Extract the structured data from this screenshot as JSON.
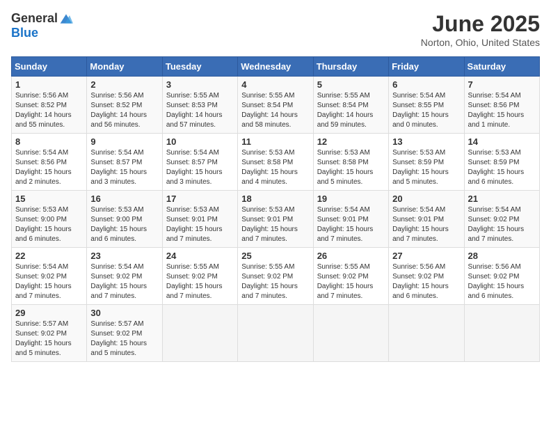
{
  "logo": {
    "general": "General",
    "blue": "Blue"
  },
  "title": "June 2025",
  "location": "Norton, Ohio, United States",
  "days_header": [
    "Sunday",
    "Monday",
    "Tuesday",
    "Wednesday",
    "Thursday",
    "Friday",
    "Saturday"
  ],
  "weeks": [
    [
      {
        "day": "1",
        "info": "Sunrise: 5:56 AM\nSunset: 8:52 PM\nDaylight: 14 hours\nand 55 minutes."
      },
      {
        "day": "2",
        "info": "Sunrise: 5:56 AM\nSunset: 8:52 PM\nDaylight: 14 hours\nand 56 minutes."
      },
      {
        "day": "3",
        "info": "Sunrise: 5:55 AM\nSunset: 8:53 PM\nDaylight: 14 hours\nand 57 minutes."
      },
      {
        "day": "4",
        "info": "Sunrise: 5:55 AM\nSunset: 8:54 PM\nDaylight: 14 hours\nand 58 minutes."
      },
      {
        "day": "5",
        "info": "Sunrise: 5:55 AM\nSunset: 8:54 PM\nDaylight: 14 hours\nand 59 minutes."
      },
      {
        "day": "6",
        "info": "Sunrise: 5:54 AM\nSunset: 8:55 PM\nDaylight: 15 hours\nand 0 minutes."
      },
      {
        "day": "7",
        "info": "Sunrise: 5:54 AM\nSunset: 8:56 PM\nDaylight: 15 hours\nand 1 minute."
      }
    ],
    [
      {
        "day": "8",
        "info": "Sunrise: 5:54 AM\nSunset: 8:56 PM\nDaylight: 15 hours\nand 2 minutes."
      },
      {
        "day": "9",
        "info": "Sunrise: 5:54 AM\nSunset: 8:57 PM\nDaylight: 15 hours\nand 3 minutes."
      },
      {
        "day": "10",
        "info": "Sunrise: 5:54 AM\nSunset: 8:57 PM\nDaylight: 15 hours\nand 3 minutes."
      },
      {
        "day": "11",
        "info": "Sunrise: 5:53 AM\nSunset: 8:58 PM\nDaylight: 15 hours\nand 4 minutes."
      },
      {
        "day": "12",
        "info": "Sunrise: 5:53 AM\nSunset: 8:58 PM\nDaylight: 15 hours\nand 5 minutes."
      },
      {
        "day": "13",
        "info": "Sunrise: 5:53 AM\nSunset: 8:59 PM\nDaylight: 15 hours\nand 5 minutes."
      },
      {
        "day": "14",
        "info": "Sunrise: 5:53 AM\nSunset: 8:59 PM\nDaylight: 15 hours\nand 6 minutes."
      }
    ],
    [
      {
        "day": "15",
        "info": "Sunrise: 5:53 AM\nSunset: 9:00 PM\nDaylight: 15 hours\nand 6 minutes."
      },
      {
        "day": "16",
        "info": "Sunrise: 5:53 AM\nSunset: 9:00 PM\nDaylight: 15 hours\nand 6 minutes."
      },
      {
        "day": "17",
        "info": "Sunrise: 5:53 AM\nSunset: 9:01 PM\nDaylight: 15 hours\nand 7 minutes."
      },
      {
        "day": "18",
        "info": "Sunrise: 5:53 AM\nSunset: 9:01 PM\nDaylight: 15 hours\nand 7 minutes."
      },
      {
        "day": "19",
        "info": "Sunrise: 5:54 AM\nSunset: 9:01 PM\nDaylight: 15 hours\nand 7 minutes."
      },
      {
        "day": "20",
        "info": "Sunrise: 5:54 AM\nSunset: 9:01 PM\nDaylight: 15 hours\nand 7 minutes."
      },
      {
        "day": "21",
        "info": "Sunrise: 5:54 AM\nSunset: 9:02 PM\nDaylight: 15 hours\nand 7 minutes."
      }
    ],
    [
      {
        "day": "22",
        "info": "Sunrise: 5:54 AM\nSunset: 9:02 PM\nDaylight: 15 hours\nand 7 minutes."
      },
      {
        "day": "23",
        "info": "Sunrise: 5:54 AM\nSunset: 9:02 PM\nDaylight: 15 hours\nand 7 minutes."
      },
      {
        "day": "24",
        "info": "Sunrise: 5:55 AM\nSunset: 9:02 PM\nDaylight: 15 hours\nand 7 minutes."
      },
      {
        "day": "25",
        "info": "Sunrise: 5:55 AM\nSunset: 9:02 PM\nDaylight: 15 hours\nand 7 minutes."
      },
      {
        "day": "26",
        "info": "Sunrise: 5:55 AM\nSunset: 9:02 PM\nDaylight: 15 hours\nand 7 minutes."
      },
      {
        "day": "27",
        "info": "Sunrise: 5:56 AM\nSunset: 9:02 PM\nDaylight: 15 hours\nand 6 minutes."
      },
      {
        "day": "28",
        "info": "Sunrise: 5:56 AM\nSunset: 9:02 PM\nDaylight: 15 hours\nand 6 minutes."
      }
    ],
    [
      {
        "day": "29",
        "info": "Sunrise: 5:57 AM\nSunset: 9:02 PM\nDaylight: 15 hours\nand 5 minutes."
      },
      {
        "day": "30",
        "info": "Sunrise: 5:57 AM\nSunset: 9:02 PM\nDaylight: 15 hours\nand 5 minutes."
      },
      null,
      null,
      null,
      null,
      null
    ]
  ]
}
